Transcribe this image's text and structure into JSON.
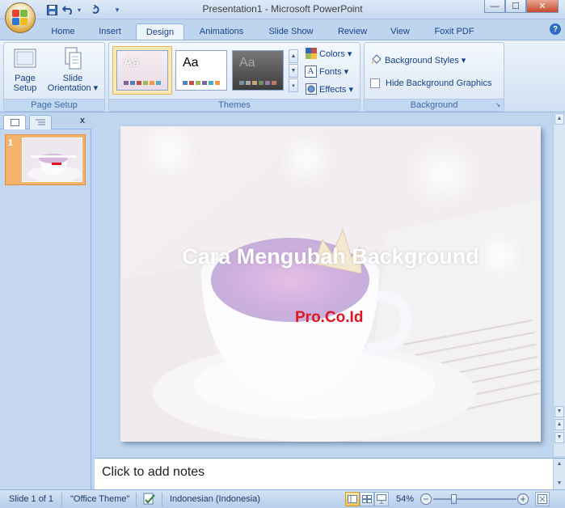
{
  "window": {
    "title": "Presentation1 - Microsoft PowerPoint",
    "controls": {
      "minimize": "—",
      "maximize": "☐",
      "close": "✕"
    }
  },
  "quick_access": {
    "save_icon": "save-icon",
    "undo_icon": "undo-icon",
    "redo_icon": "redo-icon"
  },
  "tabs": [
    "Home",
    "Insert",
    "Design",
    "Animations",
    "Slide Show",
    "Review",
    "View",
    "Foxit PDF"
  ],
  "active_tab": "Design",
  "ribbon": {
    "page_setup_group": {
      "label": "Page Setup",
      "page_setup_btn": {
        "line1": "Page",
        "line2": "Setup"
      },
      "orientation_btn": {
        "line1": "Slide",
        "line2": "Orientation ▾"
      }
    },
    "themes_group": {
      "label": "Themes",
      "theme_aa": "Aa",
      "colors": "Colors ▾",
      "fonts": "Fonts ▾",
      "effects": "Effects ▾"
    },
    "background_group": {
      "label": "Background",
      "background_styles": "Background Styles ▾",
      "hide_graphics": "Hide Background Graphics",
      "hide_graphics_checked": false
    }
  },
  "slides_panel": {
    "close": "x",
    "slide_number": "1"
  },
  "slide": {
    "title": "Cara Mengubah Background",
    "subtitle": "Pro.Co.Id",
    "subtitle_color": "#e0161f"
  },
  "notes": {
    "placeholder": "Click to add notes"
  },
  "status": {
    "slide": "Slide 1 of 1",
    "theme": "\"Office Theme\"",
    "language": "Indonesian (Indonesia)",
    "zoom": "54%",
    "zoom_level": 0.54
  }
}
